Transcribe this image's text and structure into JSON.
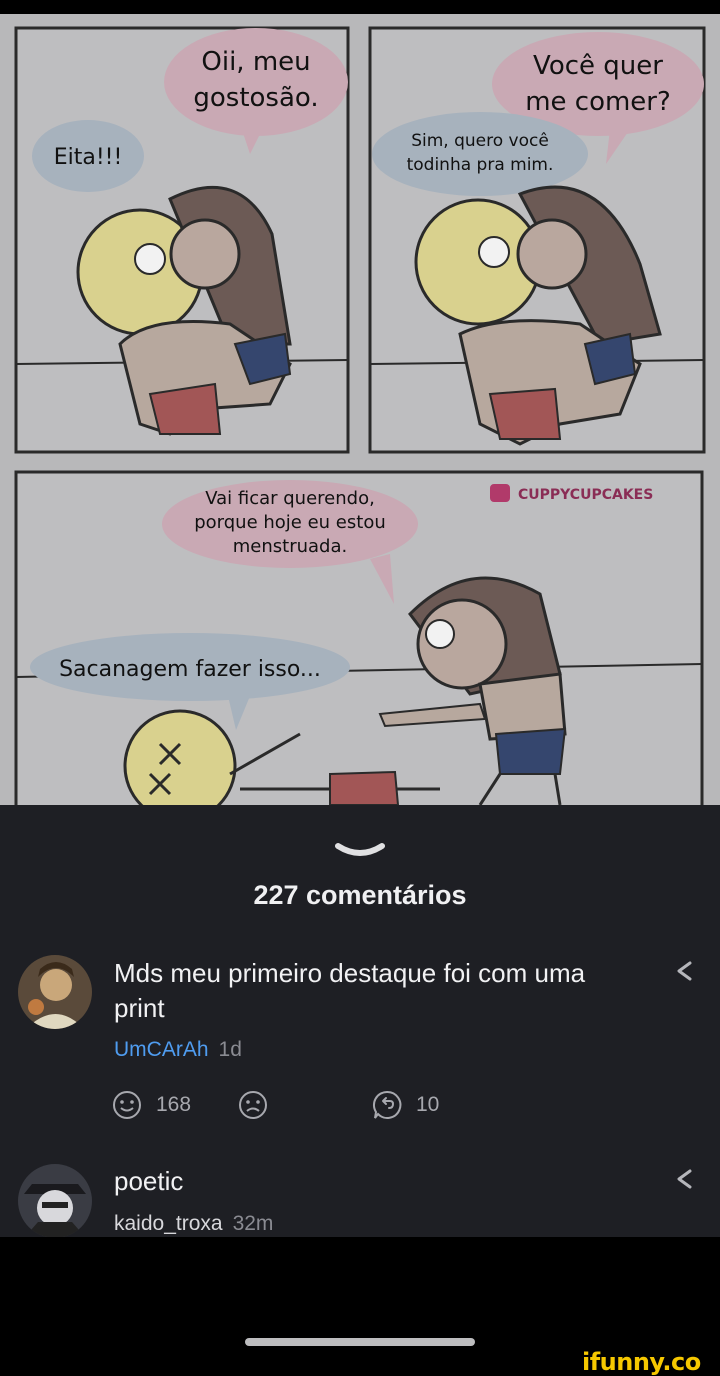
{
  "comic": {
    "panel1_bubble_girl": [
      "Oii, meu",
      "gostosão."
    ],
    "panel1_bubble_boy": "Eita!!!",
    "panel2_bubble_girl": [
      "Você quer",
      "me comer?"
    ],
    "panel2_bubble_boy": [
      "Sim, quero você",
      "todinha pra mim."
    ],
    "panel3_bubble_girl": [
      "Vai ficar querendo,",
      "porque hoje eu estou",
      "menstruada."
    ],
    "panel3_bubble_boy": "Sacanagem fazer isso...",
    "signature": "CUPPYCUPCAKES"
  },
  "comments_header": {
    "count_label": "227 comentários"
  },
  "comments": [
    {
      "text": "Mds meu primeiro destaque foi com uma print",
      "username": "UmCArAh",
      "time": "1d",
      "smile_count": "168",
      "replies_count": "10"
    },
    {
      "text": "poetic",
      "username": "kaido_troxa",
      "time": "32m"
    }
  ],
  "watermark": "ifunny.co",
  "icons": {
    "collapse": "chevron-down-icon",
    "share": "share-icon",
    "smile": "smile-icon",
    "frown": "frown-icon",
    "reply": "reply-icon"
  }
}
